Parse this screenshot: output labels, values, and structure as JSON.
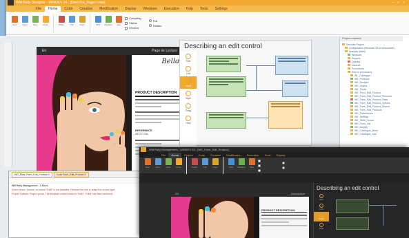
{
  "window": {
    "title": "WM Rally Designer - WINDEV 24 - [Describe_Pages.wdw]",
    "menu_tabs": [
      "File",
      "Home",
      "Code",
      "Creation",
      "Modification",
      "Display",
      "Windows",
      "Execution",
      "Help",
      "Tools",
      "Settings"
    ],
    "active_tab_index": 1,
    "options": [
      "Full",
      "Hidden"
    ]
  },
  "ribbon": {
    "buttons": [
      "New",
      "Open",
      "Save",
      "Close",
      "Paste",
      "Cut",
      "Copy",
      "Find",
      "Replace",
      "Test"
    ],
    "checkboxes": [
      "Compiling",
      "Visible",
      "Window"
    ],
    "icon_colors": [
      "#e06e2c",
      "#5b9bd5",
      "#77b255",
      "#f2a72e",
      "#c94e4e",
      "#5b9bd5",
      "#d9a32e",
      "#4a90d9",
      "#6ab04c",
      "#e06e2c"
    ]
  },
  "page": {
    "left_header": "Eti",
    "right_header": "Page de Lecture",
    "signature": "Bella",
    "desc_title": "PRODUCT DESCRIPTION",
    "ref_label": "REFERENCE",
    "ref_value": "ZE 27 726"
  },
  "tutorial": {
    "title": "Describing an edit control",
    "steps": [
      "Edit",
      "Link",
      "Input",
      "Style",
      "Drag",
      "Help"
    ],
    "active_step": 2
  },
  "tree": {
    "header": "Project explorer",
    "items": [
      "Describe Project",
      "Configuration (Windows 32-bit executable)",
      "Analysis (Main)",
      "Windows",
      "Reports",
      "Queries",
      "Classes",
      "Procedures",
      "Sets of procedures",
      "WL_Catalogue",
      "WE_Products",
      "WE_Recipes",
      "WE_Orders",
      "WE_Prices",
      "WE_Form_Edit_Product",
      "WE_Form_Edit_Product_Personal",
      "WE_Form_Edit_Product_Fixed",
      "WE_Form_Edit_Product_Options",
      "WE_Form_Edit_Product_Search",
      "WE_Form_Edit_Products",
      "WE_Preferences",
      "WE_Settings",
      "WE_Table_Cursor",
      "WE_Form_List",
      "WE_Display",
      "WE_Catalogue_Items",
      "WE_Catalogue_Add"
    ]
  },
  "messages": {
    "tabs": [
      "WD_Blow_Form_Edit_Product.S",
      "Code Form_Edit_Product.S"
    ],
    "header": "WR Rally Management - 1 Error",
    "lines": [
      "Some errors: 'Iconize' of control 'Edit2' is not available. Remove the line or adapt the control type.",
      "Project Options: Project group. The template control linked to 'Edit2', 'Edit3' has been removed."
    ]
  },
  "dark_window": {
    "title": "WM Rally Management - WINDEV 24 - [WE_Form_Edit_Product]",
    "menu_tabs": [
      "File",
      "Home",
      "Project",
      "Code",
      "Creation",
      "Modification",
      "Execution",
      "Tools",
      "Display"
    ],
    "active_tab_index": 1,
    "tutorial_title": "Describing an edit control",
    "page_left_header": "Eti",
    "page_right_header": "Description",
    "desc_title": "PRODUCT DESCRIPTION",
    "steps": [
      "Edit",
      "Link",
      "Input",
      "Style"
    ],
    "active_step": 2
  }
}
